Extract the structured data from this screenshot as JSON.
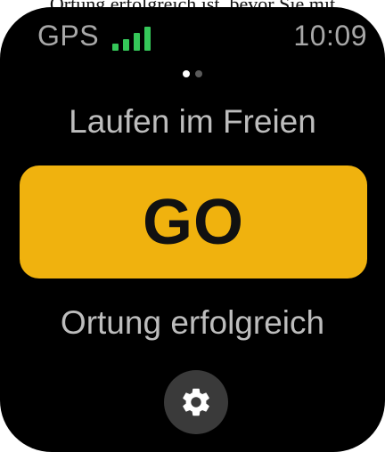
{
  "caption": "Ortung erfolgreich ist, bevor Sie mit",
  "status_bar": {
    "gps_label": "GPS",
    "signal_icon": "signal-bars-icon",
    "signal_bars": 4,
    "signal_color": "#35c759",
    "time": "10:09"
  },
  "pager": {
    "pages": 2,
    "active": 0,
    "active_color": "#ffffff",
    "inactive_color": "#5a5a5a"
  },
  "workout": {
    "title": "Laufen im Freien"
  },
  "go_button": {
    "label": "GO",
    "color": "#f0b20e"
  },
  "location_status": "Ortung erfolgreich",
  "settings_button": {
    "icon": "gear-icon"
  }
}
